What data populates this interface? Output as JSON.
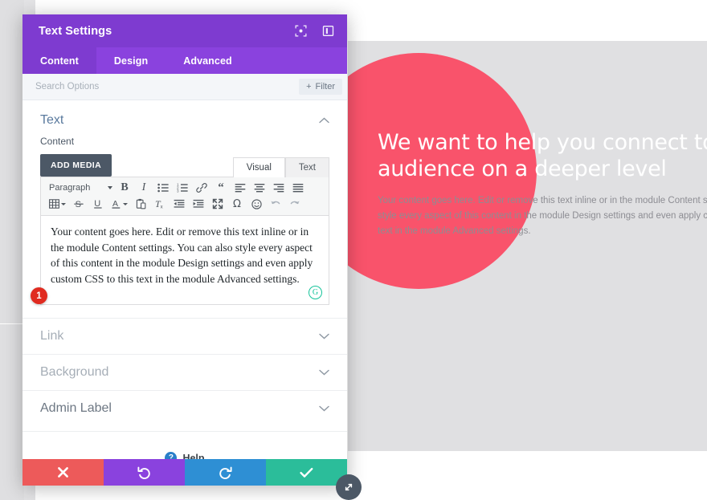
{
  "modal": {
    "title": "Text Settings",
    "title_icons": [
      {
        "name": "expand-icon",
        "label": "Expand"
      },
      {
        "name": "layout-toggle-icon",
        "label": "Change Layout"
      }
    ],
    "tabs": [
      {
        "label": "Content",
        "active": true
      },
      {
        "label": "Design",
        "active": false
      },
      {
        "label": "Advanced",
        "active": false
      }
    ],
    "search": {
      "placeholder": "Search Options",
      "value": ""
    },
    "filter_button": {
      "label": "Filter",
      "icon": "plus-icon"
    },
    "sections": {
      "text": {
        "title": "Text",
        "chevron": "chevron-up-icon",
        "content_label": "Content",
        "add_media_label": "ADD MEDIA",
        "editor_tabs": [
          {
            "label": "Visual",
            "active": true
          },
          {
            "label": "Text",
            "active": false
          }
        ],
        "toolbar_row1": [
          {
            "name": "format-select",
            "label": "Paragraph"
          },
          {
            "name": "bold-icon",
            "glyph": "B"
          },
          {
            "name": "italic-icon",
            "glyph": "I"
          },
          {
            "name": "bulleted-list-icon",
            "glyph": ""
          },
          {
            "name": "numbered-list-icon",
            "glyph": ""
          },
          {
            "name": "link-icon",
            "glyph": ""
          },
          {
            "name": "blockquote-icon",
            "glyph": "“"
          },
          {
            "name": "align-left-icon",
            "glyph": ""
          },
          {
            "name": "align-center-icon",
            "glyph": ""
          },
          {
            "name": "align-right-icon",
            "glyph": ""
          },
          {
            "name": "align-justify-icon",
            "glyph": ""
          }
        ],
        "toolbar_row2": [
          {
            "name": "table-icon",
            "glyph": ""
          },
          {
            "name": "strikethrough-icon",
            "glyph": "S"
          },
          {
            "name": "underline-icon",
            "glyph": "U"
          },
          {
            "name": "text-color-icon",
            "glyph": "A"
          },
          {
            "name": "paste-as-text-icon",
            "glyph": ""
          },
          {
            "name": "clear-formatting-icon",
            "glyph": ""
          },
          {
            "name": "outdent-icon",
            "glyph": ""
          },
          {
            "name": "indent-icon",
            "glyph": ""
          },
          {
            "name": "fullscreen-icon",
            "glyph": ""
          },
          {
            "name": "special-character-icon",
            "glyph": "Ω"
          },
          {
            "name": "emoji-icon",
            "glyph": "☺"
          },
          {
            "name": "undo-icon",
            "glyph": "↶"
          },
          {
            "name": "redo-icon",
            "glyph": "↷"
          }
        ],
        "editor_value": "Your content goes here. Edit or remove this text inline or in the module Content settings. You can also style every aspect of this content in the module Design settings and even apply custom CSS to this text in the module Advanced settings.",
        "grammarly_badge": "G",
        "step_badge": "1"
      },
      "collapsed": [
        {
          "title": "Link",
          "chevron": "chevron-down-icon"
        },
        {
          "title": "Background",
          "chevron": "chevron-down-icon"
        },
        {
          "title": "Admin Label",
          "chevron": "chevron-down-icon"
        }
      ]
    },
    "help": {
      "icon": "question-mark-icon",
      "label": "Help"
    },
    "footer_buttons": [
      {
        "name": "cancel-button",
        "icon": "close-icon",
        "glyph": "✖",
        "color": "#ed5a5a"
      },
      {
        "name": "undo-button",
        "icon": "undo-arrow-icon",
        "glyph": "↺",
        "color": "#8a42de"
      },
      {
        "name": "redo-button",
        "icon": "redo-arrow-icon",
        "glyph": "↻",
        "color": "#2e8fd4"
      },
      {
        "name": "save-button",
        "icon": "checkmark-icon",
        "glyph": "✔",
        "color": "#2bbd9a"
      }
    ],
    "resize_handle_icon": "resize-diagonal-icon"
  },
  "page": {
    "hero_title_line1": "We want to help you connect to your",
    "hero_title_line2": "audience on a deeper level",
    "hero_body_line1": "Your content goes here. Edit or remove this text inline or in the module Content settings.",
    "hero_body_line2": "style every aspect of this content in the module Design settings and even apply custom C",
    "hero_body_line3": "text in the module Advanced settings."
  },
  "colors": {
    "modal_header": "#7e3bd0",
    "modal_tabs": "#8a42de",
    "accent_pink": "#f9536b",
    "page_grey": "#e0e0e2",
    "save_green": "#2bbd9a",
    "cancel_red": "#ed5a5a",
    "redo_blue": "#2e8fd4",
    "badge_red": "#e02b20"
  }
}
